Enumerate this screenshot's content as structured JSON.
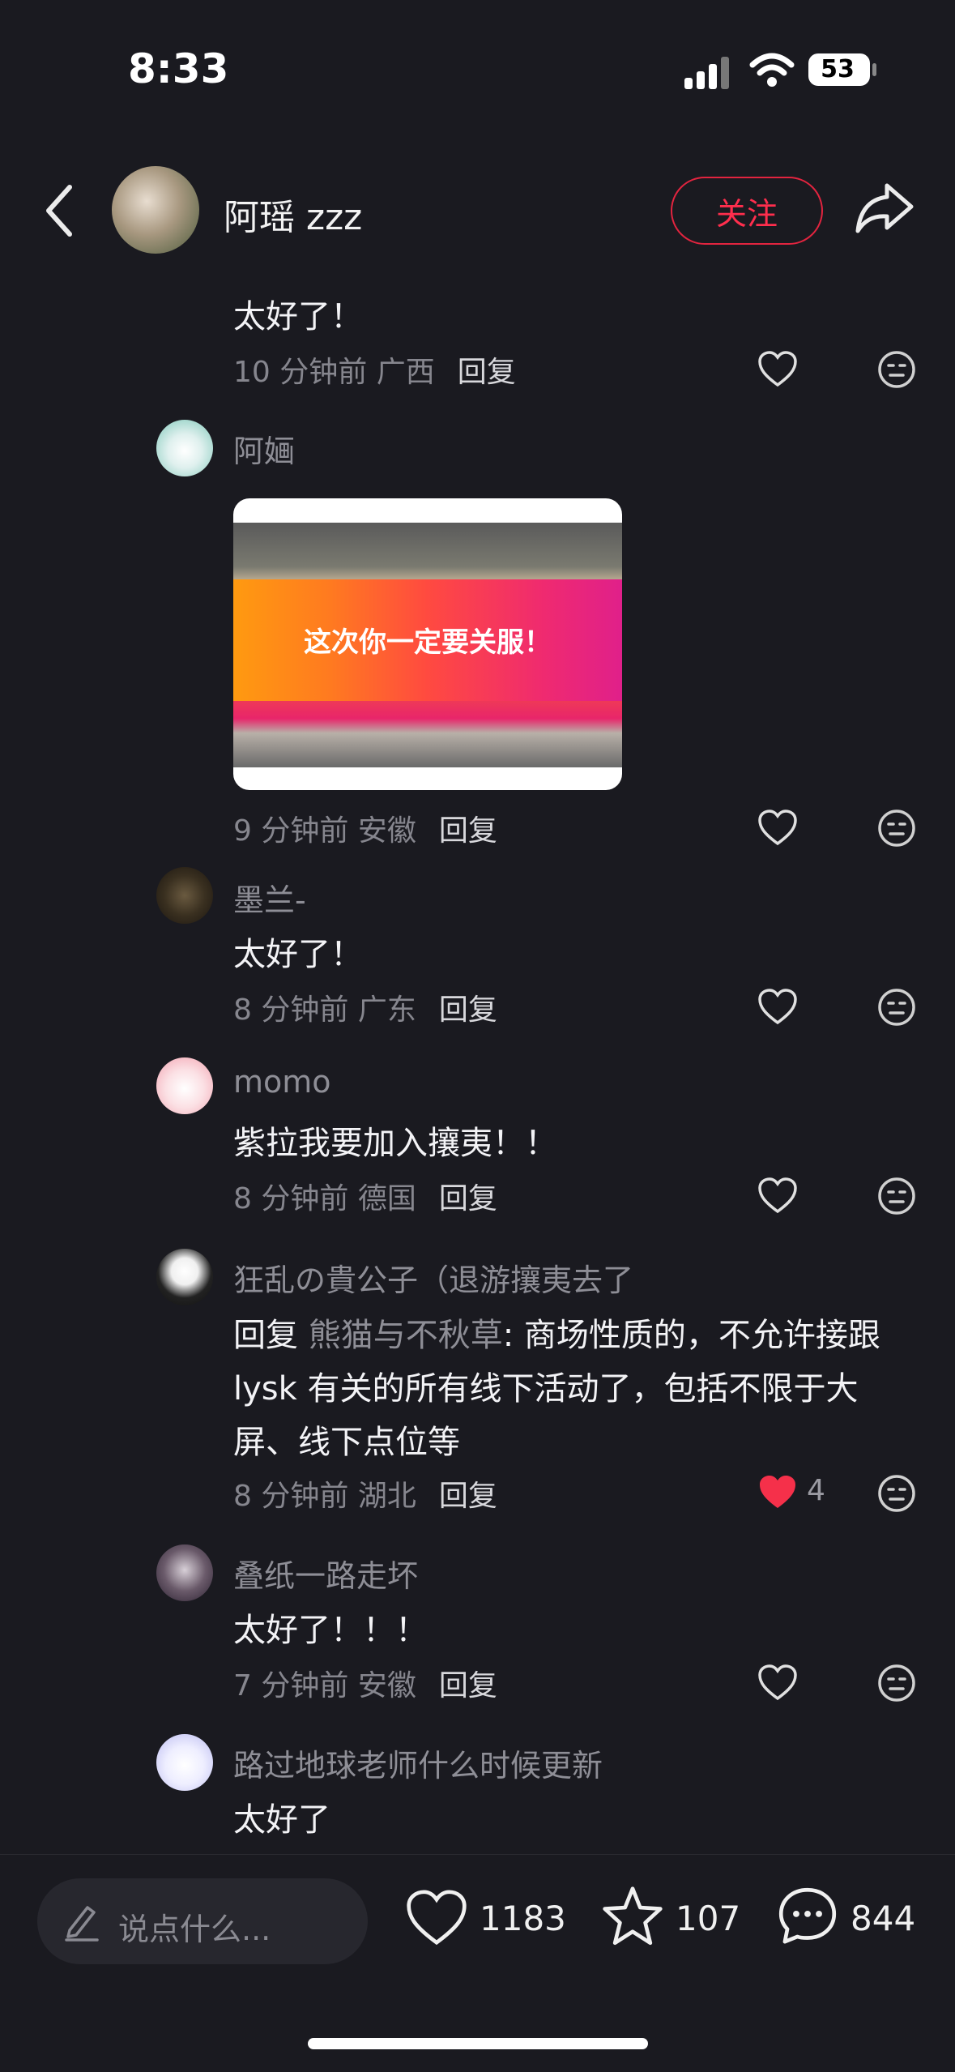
{
  "status_bar": {
    "time": "8:33",
    "battery": "53"
  },
  "header": {
    "user_name": "阿瑶 zzz",
    "follow_label": "关注"
  },
  "comments": [
    {
      "name": "",
      "text": "太好了！",
      "time": "10 分钟前",
      "location": "广西",
      "reply_label": "回复",
      "liked": false
    },
    {
      "name": "阿婳",
      "sticker_text": "这次你一定要关服！",
      "time": "9 分钟前",
      "location": "安徽",
      "reply_label": "回复",
      "liked": false
    },
    {
      "name": "墨兰-",
      "text": "太好了！",
      "time": "8 分钟前",
      "location": "广东",
      "reply_label": "回复",
      "liked": false
    },
    {
      "name": "momo",
      "text": "紫拉我要加入攘夷！！",
      "time": "8 分钟前",
      "location": "德国",
      "reply_label": "回复",
      "liked": false
    },
    {
      "name": "狂乱の貴公子（退游攘夷去了",
      "reply_prefix": "回复",
      "reply_to": "熊猫与不秋草",
      "text_line1": ": 商场性质的，不允许接跟",
      "text_line2": "lysk 有关的所有线下活动了，包括不限于大",
      "text_line3": "屏、线下点位等",
      "time": "8 分钟前",
      "location": "湖北",
      "reply_label": "回复",
      "liked": true,
      "likes": "4"
    },
    {
      "name": "叠纸一路走坏",
      "text": "太好了！！！",
      "time": "7 分钟前",
      "location": "安徽",
      "reply_label": "回复",
      "liked": false
    },
    {
      "name": "路过地球老师什么时候更新",
      "text": "太好了"
    }
  ],
  "bottom_bar": {
    "input_placeholder": "说点什么...",
    "likes": "1183",
    "favorites": "107",
    "comments": "844"
  },
  "colors": {
    "background": "#1a1a20",
    "accent_red": "#ff2e4d",
    "like_red": "#f5304a"
  },
  "icons": [
    "back-icon",
    "share-icon",
    "heart-icon",
    "emoji-icon",
    "pen-icon",
    "star-icon",
    "comment-icon",
    "signal-icon",
    "wifi-icon",
    "battery-icon"
  ]
}
